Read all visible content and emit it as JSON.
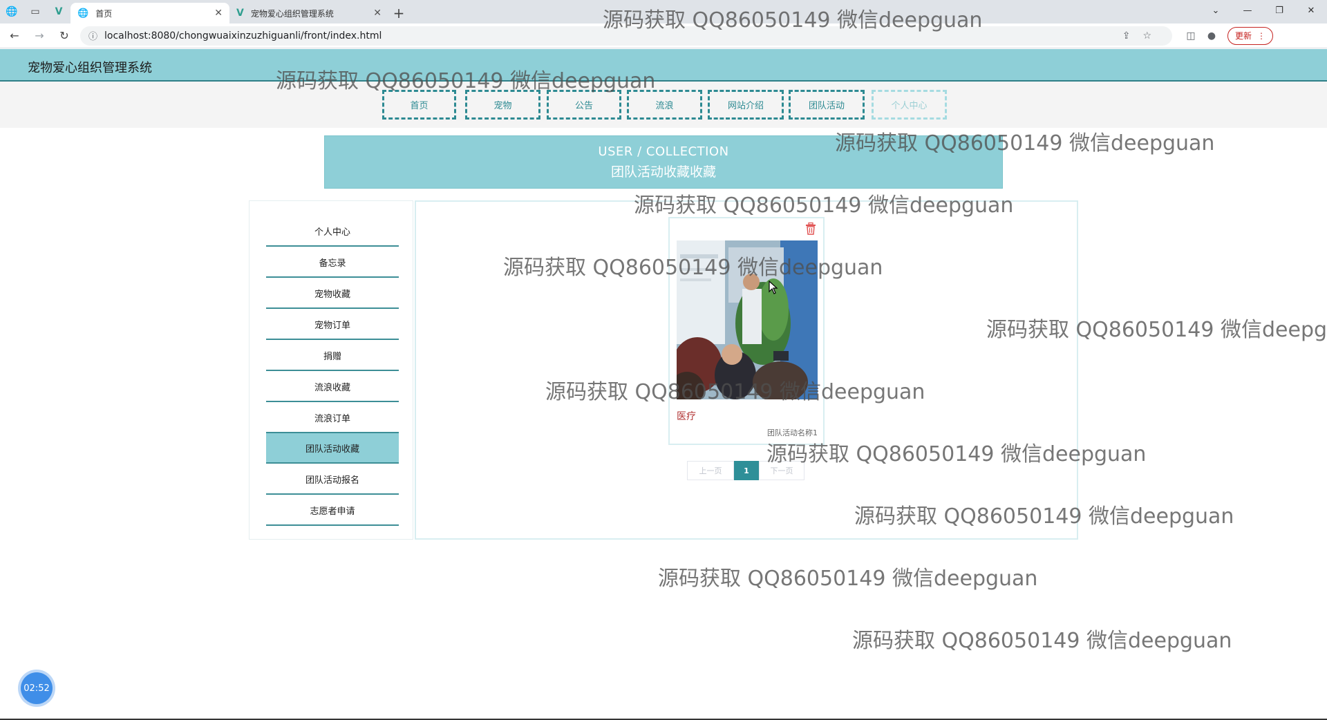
{
  "browser": {
    "tabs": [
      {
        "title": "首页",
        "active": true
      },
      {
        "title": "宠物爱心组织管理系统",
        "active": false
      }
    ],
    "url": "localhost:8080/chongwuaixinzuzhiguanli/front/index.html",
    "update_label": "更新"
  },
  "site": {
    "title": "宠物爱心组织管理系统",
    "nav": [
      "首页",
      "宠物",
      "公告",
      "流浪",
      "网站介绍",
      "团队活动",
      "个人中心"
    ]
  },
  "banner": {
    "en": "USER / COLLECTION",
    "cn": "团队活动收藏收藏"
  },
  "sidebar": {
    "items": [
      "个人中心",
      "备忘录",
      "宠物收藏",
      "宠物订单",
      "捐赠",
      "流浪收藏",
      "流浪订单",
      "团队活动收藏",
      "团队活动报名",
      "志愿者申请"
    ],
    "active_index": 7
  },
  "card": {
    "tag": "医疗",
    "name": "团队活动名称1"
  },
  "pager": {
    "prev": "上一页",
    "current": "1",
    "next": "下一页"
  },
  "watermark": "源码获取 QQ86050149 微信deepguan",
  "timer": "02:52"
}
